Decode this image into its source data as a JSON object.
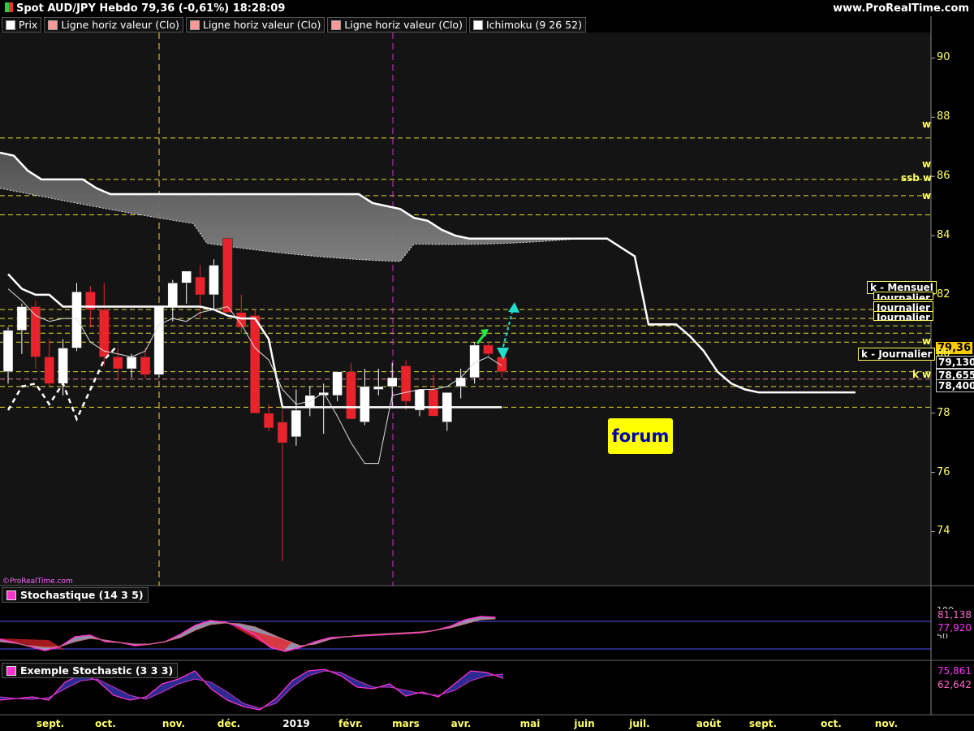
{
  "header": {
    "title": "Spot AUD/JPY Hebdo 79,36 (-0,61%) 18:28:09",
    "site": "www.ProRealTime.com",
    "copyright": "©ProRealTime.com"
  },
  "legend": [
    {
      "label": "Prix",
      "color": "#ffffff"
    },
    {
      "label": "Ligne horiz valeur (Clo)",
      "color": "#ff9999"
    },
    {
      "label": "Ligne horiz valeur (Clo)",
      "color": "#ff9999"
    },
    {
      "label": "Ligne horiz valeur (Clo)",
      "color": "#ff9999"
    },
    {
      "label": "Ichimoku (9 26 52)",
      "color": "#ffffff"
    }
  ],
  "indicators": {
    "stoch1": {
      "label": "Stochastique (14 3 5)",
      "value1": "81,138",
      "value2": "77,920",
      "lvl_top": "100",
      "lvl_bot": "50"
    },
    "stoch2": {
      "label": "Exemple Stochastic (3 3 3)",
      "value1": "75,861",
      "value2": "62,642"
    }
  },
  "forum_label": "forum",
  "right_labels": {
    "w1": "w",
    "w2": "w",
    "ssbw": "ssb w",
    "w3": "w",
    "kmensuel": "k - Mensuel",
    "journalier_a": "Journalier",
    "journalier_b": "Journalier",
    "journalier_c": "Journalier",
    "w4": "w",
    "kjournalier": "k - Journalier",
    "kw": "k w"
  },
  "price_boxes": {
    "last": "79,36",
    "p1": "79,130",
    "p2": "78,655",
    "p3": "78,400"
  },
  "colors": {
    "up": "#ffffff",
    "down": "#e8232b",
    "grid": "#ffff33",
    "cloud": "#8c8c8c",
    "stochline": "#ff33cc"
  },
  "chart_data": {
    "type": "candlestick",
    "ylim": [
      72.2,
      91
    ],
    "yticks": [
      74,
      76,
      78,
      80,
      82,
      84,
      86,
      88,
      90
    ],
    "x_labels": [
      "sept.",
      "oct.",
      "nov.",
      "déc.",
      "2019",
      "févr.",
      "mars",
      "avr.",
      "mai",
      "juin",
      "juil.",
      "août",
      "sept.",
      "oct.",
      "nov."
    ],
    "candles": [
      {
        "o": 79.4,
        "h": 80.9,
        "l": 79.0,
        "c": 80.8
      },
      {
        "o": 80.8,
        "h": 81.7,
        "l": 80.0,
        "c": 81.6
      },
      {
        "o": 81.6,
        "h": 81.8,
        "l": 79.5,
        "c": 79.9
      },
      {
        "o": 79.9,
        "h": 80.5,
        "l": 78.9,
        "c": 79.0
      },
      {
        "o": 79.0,
        "h": 80.5,
        "l": 78.6,
        "c": 80.2
      },
      {
        "o": 80.2,
        "h": 82.4,
        "l": 80.1,
        "c": 82.1
      },
      {
        "o": 82.1,
        "h": 82.3,
        "l": 80.9,
        "c": 81.5
      },
      {
        "o": 81.5,
        "h": 82.4,
        "l": 79.6,
        "c": 79.9
      },
      {
        "o": 79.9,
        "h": 80.2,
        "l": 79.1,
        "c": 79.5
      },
      {
        "o": 79.5,
        "h": 80.0,
        "l": 79.2,
        "c": 79.9
      },
      {
        "o": 79.9,
        "h": 80.2,
        "l": 79.2,
        "c": 79.3
      },
      {
        "o": 79.3,
        "h": 81.6,
        "l": 79.2,
        "c": 81.6
      },
      {
        "o": 81.6,
        "h": 82.5,
        "l": 81.1,
        "c": 82.4
      },
      {
        "o": 82.4,
        "h": 82.8,
        "l": 81.7,
        "c": 82.8
      },
      {
        "o": 82.6,
        "h": 83.0,
        "l": 81.2,
        "c": 82.0
      },
      {
        "o": 82.0,
        "h": 83.2,
        "l": 81.5,
        "c": 83.0
      },
      {
        "o": 83.9,
        "h": 84.0,
        "l": 81.6,
        "c": 81.4
      },
      {
        "o": 81.4,
        "h": 82.0,
        "l": 80.7,
        "c": 80.9
      },
      {
        "o": 81.3,
        "h": 81.5,
        "l": 78.0,
        "c": 78.0
      },
      {
        "o": 78.0,
        "h": 78.3,
        "l": 77.4,
        "c": 77.5
      },
      {
        "o": 77.7,
        "h": 78.1,
        "l": 73.0,
        "c": 77.0
      },
      {
        "o": 77.2,
        "h": 78.8,
        "l": 76.9,
        "c": 78.1
      },
      {
        "o": 78.2,
        "h": 78.9,
        "l": 77.9,
        "c": 78.6
      },
      {
        "o": 78.6,
        "h": 79.0,
        "l": 77.3,
        "c": 78.7
      },
      {
        "o": 78.6,
        "h": 79.1,
        "l": 78.4,
        "c": 79.4
      },
      {
        "o": 79.4,
        "h": 79.7,
        "l": 77.8,
        "c": 77.8
      },
      {
        "o": 77.7,
        "h": 79.5,
        "l": 77.6,
        "c": 78.9
      },
      {
        "o": 78.8,
        "h": 79.5,
        "l": 78.6,
        "c": 78.9
      },
      {
        "o": 78.9,
        "h": 79.7,
        "l": 78.2,
        "c": 79.2
      },
      {
        "o": 79.6,
        "h": 79.8,
        "l": 78.1,
        "c": 78.4
      },
      {
        "o": 78.1,
        "h": 78.8,
        "l": 77.9,
        "c": 78.8
      },
      {
        "o": 78.8,
        "h": 79.3,
        "l": 77.9,
        "c": 77.9
      },
      {
        "o": 77.7,
        "h": 78.7,
        "l": 77.4,
        "c": 78.7
      },
      {
        "o": 78.9,
        "h": 79.5,
        "l": 78.5,
        "c": 79.2
      },
      {
        "o": 79.2,
        "h": 80.4,
        "l": 79.0,
        "c": 80.3
      },
      {
        "o": 80.3,
        "h": 80.4,
        "l": 79.9,
        "c": 80.0
      },
      {
        "o": 79.9,
        "h": 80.1,
        "l": 79.2,
        "c": 79.4
      }
    ],
    "tenkan": [
      86.8,
      86.7,
      86.0,
      85.8,
      85.7,
      85.6,
      85.4,
      85.3,
      85.2,
      85.0,
      84.8,
      84.7,
      84.6,
      84.5,
      84.5,
      84.5,
      84.6,
      84.7,
      84.8,
      84.9,
      85.0,
      84.5,
      84.3,
      83.9,
      83.7,
      83.4,
      83.2,
      82.6,
      82.3,
      82.0,
      81.8,
      81.7,
      81.6,
      81.6,
      81.6,
      81.6,
      81.5,
      81.3,
      81.2,
      81.1,
      81.2,
      81.3,
      81.4,
      81.5,
      81.4,
      81.2,
      81.0,
      80.4,
      79.7,
      78.9,
      78.5,
      78.3,
      78.2,
      78.2,
      78.2,
      78.3,
      78.3,
      78.4,
      78.6,
      78.7,
      78.7,
      78.7,
      78.7
    ],
    "kumo_top": [
      86.8,
      86.7,
      86.2,
      85.9,
      85.9,
      85.9,
      85.9,
      85.6,
      85.4,
      85.4,
      85.4,
      85.4,
      85.4,
      85.4,
      85.4,
      85.4,
      85.4,
      85.4,
      85.4,
      85.4,
      85.4,
      85.4,
      85.4,
      85.4,
      85.4,
      85.4,
      85.4,
      85.1,
      85.0,
      84.9,
      84.6,
      84.5,
      84.2,
      84.0,
      83.9,
      83.9,
      83.9,
      83.9,
      83.9,
      83.9,
      83.9,
      83.9,
      83.9,
      83.9,
      83.9,
      83.6,
      83.3,
      81.0,
      81.0,
      81.0,
      80.6,
      80.1,
      79.4,
      79.0,
      78.8,
      78.7,
      78.7,
      78.7,
      78.7,
      78.7,
      78.7,
      78.7,
      78.7
    ]
  }
}
